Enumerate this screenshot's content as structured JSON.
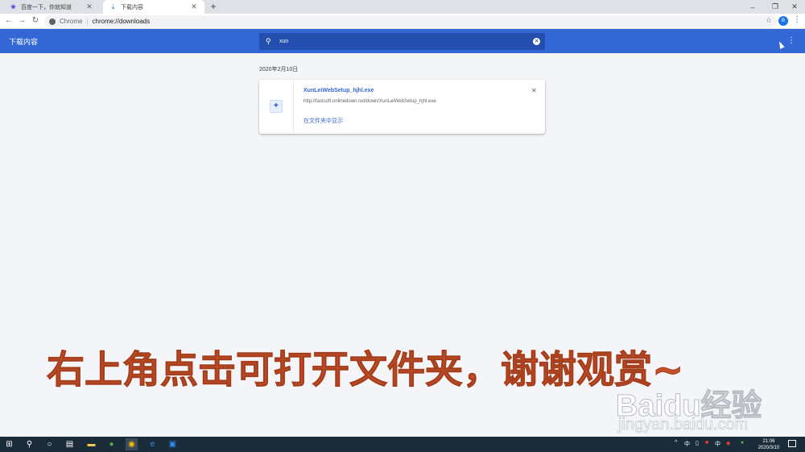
{
  "browser": {
    "tabs": [
      {
        "label": "百度一下，你就知道",
        "icon": "baidu-paw-icon"
      },
      {
        "label": "下载内容",
        "icon": "download-icon"
      }
    ],
    "new_tab": "+",
    "window_controls": {
      "minimize": "–",
      "restore": "❐",
      "close": "✕"
    },
    "omnibox": {
      "scheme_label": "Chrome",
      "url": "chrome://downloads"
    },
    "profile_initial": "B"
  },
  "downloads_page": {
    "title": "下载内容",
    "search": {
      "value": "xun"
    },
    "date_group": "2020年2月10日",
    "items": [
      {
        "file_name": "XunLeiWebSetup_hjhl.exe",
        "source_url": "http://fastsoft.onlinedown.net/down/XunLeiWebSetup_hjhl.exe",
        "show_in_folder": "在文件夹中显示"
      }
    ]
  },
  "overlay": {
    "caption": "右上角点击可打开文件夹，谢谢观赏~",
    "watermark_brand": "Baidu经验",
    "watermark_url": "jingyan.baidu.com",
    "caption_color": "#c2502b"
  },
  "taskbar": {
    "tray_text": [
      "^",
      "中",
      "中"
    ],
    "time": "21:06",
    "date": "2020/3/10"
  },
  "colors": {
    "header_blue": "#3367d6",
    "search_bg": "#254fae",
    "link_blue": "#3367d6",
    "page_bg": "#f3f5f8"
  }
}
